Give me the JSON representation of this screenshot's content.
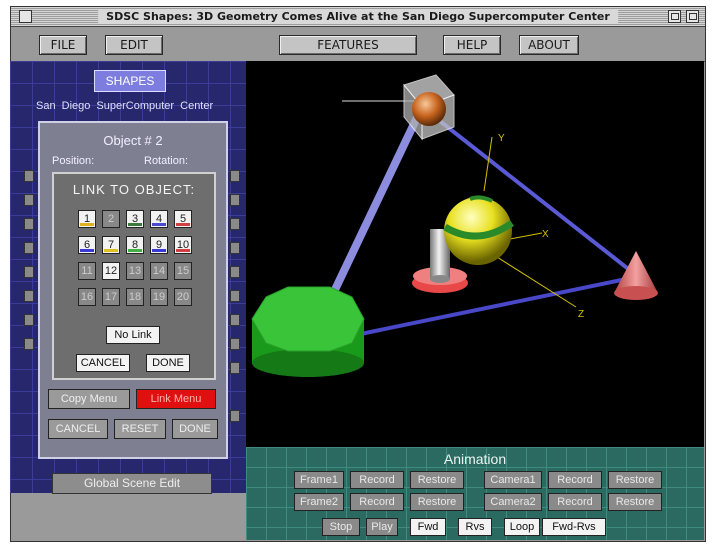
{
  "window": {
    "title": "SDSC Shapes: 3D Geometry Comes Alive at the San Diego Supercomputer Center"
  },
  "menu": {
    "file": "FILE",
    "edit": "EDIT",
    "features": "FEATURES",
    "help": "HELP",
    "about": "ABOUT"
  },
  "left_panel": {
    "shapes_button": "SHAPES",
    "sdsc_label": "San Diego SuperComputer Center",
    "global_scene_edit": "Global Scene Edit"
  },
  "object_dialog": {
    "title": "Object # 2",
    "position_label": "Position:",
    "rotation_label": "Rotation:",
    "copy_menu": "Copy Menu",
    "link_menu": "Link Menu",
    "cancel": "CANCEL",
    "reset": "RESET",
    "done": "DONE"
  },
  "link_dialog": {
    "title": "LINK TO OBJECT:",
    "objects": [
      {
        "label": "1",
        "enabled": true,
        "color": "#e0b020"
      },
      {
        "label": "2",
        "enabled": false,
        "color": ""
      },
      {
        "label": "3",
        "enabled": true,
        "color": "#3a7a3a"
      },
      {
        "label": "4",
        "enabled": true,
        "color": "#4a4ad0"
      },
      {
        "label": "5",
        "enabled": true,
        "color": "#d04040"
      },
      {
        "label": "6",
        "enabled": true,
        "color": "#3a3ad0"
      },
      {
        "label": "7",
        "enabled": true,
        "color": "#e0c020"
      },
      {
        "label": "8",
        "enabled": true,
        "color": "#40b040"
      },
      {
        "label": "9",
        "enabled": true,
        "color": "#3a3ad0"
      },
      {
        "label": "10",
        "enabled": true,
        "color": "#d04040"
      },
      {
        "label": "11",
        "enabled": false,
        "color": ""
      },
      {
        "label": "12",
        "enabled": true,
        "color": ""
      },
      {
        "label": "13",
        "enabled": false,
        "color": ""
      },
      {
        "label": "14",
        "enabled": false,
        "color": ""
      },
      {
        "label": "15",
        "enabled": false,
        "color": ""
      },
      {
        "label": "16",
        "enabled": false,
        "color": ""
      },
      {
        "label": "17",
        "enabled": false,
        "color": ""
      },
      {
        "label": "18",
        "enabled": false,
        "color": ""
      },
      {
        "label": "19",
        "enabled": false,
        "color": ""
      },
      {
        "label": "20",
        "enabled": false,
        "color": ""
      }
    ],
    "no_link": "No Link",
    "cancel": "CANCEL",
    "done": "DONE"
  },
  "scene": {
    "axis_labels": {
      "y": "Y",
      "x": "X",
      "z": "Z"
    }
  },
  "animation": {
    "title": "Animation",
    "row1": [
      "Frame1",
      "Record",
      "Restore",
      "Camera1",
      "Record",
      "Restore"
    ],
    "row2": [
      "Frame2",
      "Record",
      "Restore",
      "Camera2",
      "Record",
      "Restore"
    ],
    "stop": "Stop",
    "play": "Play",
    "fwd": "Fwd",
    "rvs": "Rvs",
    "loop": "Loop",
    "fwd_rvs": "Fwd-Rvs"
  },
  "colors": {
    "link_menu_active": "#e01010",
    "scene_background": "#000000",
    "left_panel": "#27276e",
    "animation_panel": "#2b6a60"
  }
}
